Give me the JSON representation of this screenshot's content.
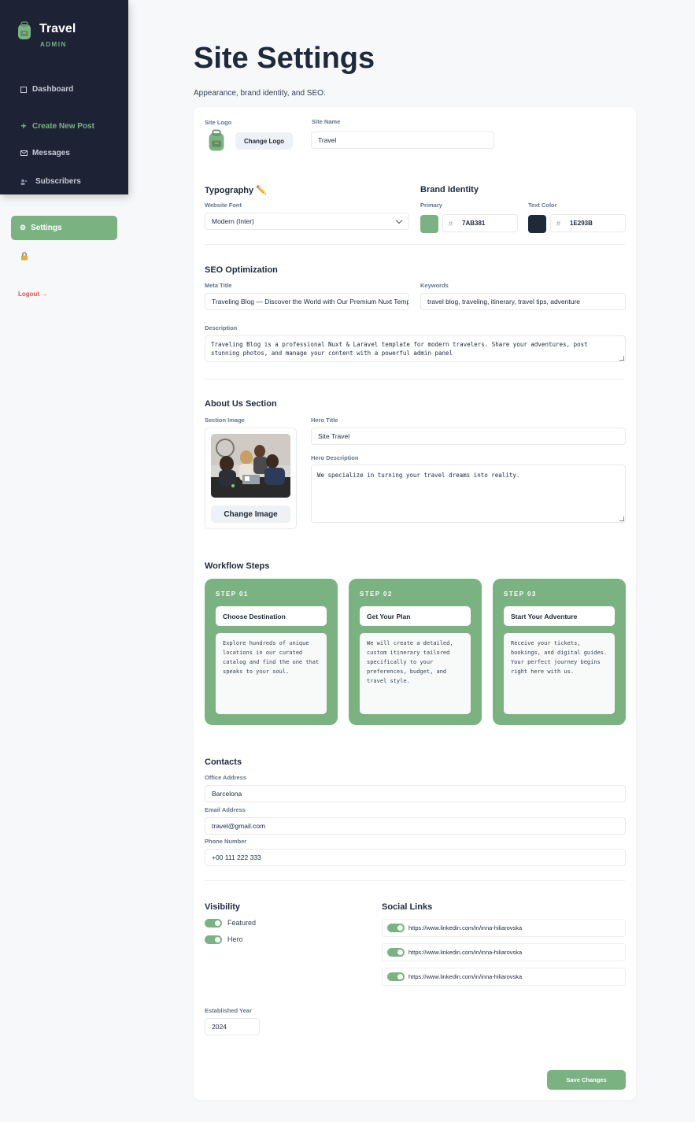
{
  "sidebar": {
    "brand_name": "Travel",
    "brand_sub": "ADMIN",
    "items": [
      {
        "label": "Dashboard",
        "icon": "square-icon"
      },
      {
        "label": "Create New Post",
        "icon": "plus-icon"
      },
      {
        "label": "Messages",
        "icon": "mail-icon"
      },
      {
        "label": "Subscribers",
        "icon": "users-icon"
      },
      {
        "label": "Settings",
        "icon": "gear-icon"
      }
    ],
    "logout": "Logout →"
  },
  "page": {
    "title": "Site Settings",
    "subtitle": "Appearance, brand identity, and SEO."
  },
  "general": {
    "logo_label": "Site Logo",
    "change_logo": "Change Logo",
    "name_label": "Site Name",
    "name_value": "Travel"
  },
  "typography": {
    "title": "Typography",
    "font_label": "Website Font",
    "font_value": "Modern (Inter)"
  },
  "brand": {
    "title": "Brand Identity",
    "primary_label": "Primary",
    "primary_value": "7AB381",
    "text_label": "Text Color",
    "text_value": "1E293B",
    "hash": "#",
    "primary_color": "#7AB381",
    "text_color": "#1E293B"
  },
  "seo": {
    "title": "SEO Optimization",
    "meta_label": "Meta Title",
    "meta_value": "Traveling Blog — Discover the World with Our Premium Nuxt Temp",
    "keywords_label": "Keywords",
    "keywords_value": "travel blog, traveling, itinerary, travel tips, adventure",
    "description_label": "Description",
    "description_value": "Traveling Blog is a professional Nuxt & Laravel template for modern travelers. Share your adventures, post stunning photos, and manage your content with a powerful admin panel"
  },
  "about": {
    "title": "About Us Section",
    "image_label": "Section Image",
    "change_image": "Change Image",
    "hero_title_label": "Hero Title",
    "hero_title_value": "Site Travel",
    "hero_desc_label": "Hero Description",
    "hero_desc_value": "We specialize in turning your travel dreams into reality."
  },
  "workflow": {
    "title": "Workflow Steps",
    "steps": [
      {
        "label": "STEP 01",
        "title": "Choose Destination",
        "desc": "Explore hundreds of unique locations in our curated catalog and find the one that speaks to your soul."
      },
      {
        "label": "STEP 02",
        "title": "Get Your Plan",
        "desc": "We will create a detailed, custom itinerary tailored specifically to your preferences, budget, and travel style."
      },
      {
        "label": "STEP 03",
        "title": "Start Your Adventure",
        "desc": "Receive your tickets, bookings, and digital guides. Your perfect journey begins right here with us."
      }
    ]
  },
  "contacts": {
    "title": "Contacts",
    "address_label": "Office Address",
    "address_value": "Barcelona",
    "email_label": "Email Address",
    "email_value": "travel@gmail.com",
    "phone_label": "Phone Number",
    "phone_value": "+00 111 222 333"
  },
  "visibility": {
    "title": "Visibility",
    "featured": "Featured",
    "hero": "Hero"
  },
  "social": {
    "title": "Social Links",
    "links": [
      "https://www.linkedin.com/in/inna-hiliarovska",
      "https://www.linkedin.com/in/inna-hiliarovska",
      "https://www.linkedin.com/in/inna-hiliarovska"
    ]
  },
  "established": {
    "label": "Established Year",
    "value": "2024"
  },
  "actions": {
    "save": "Save Changes"
  }
}
